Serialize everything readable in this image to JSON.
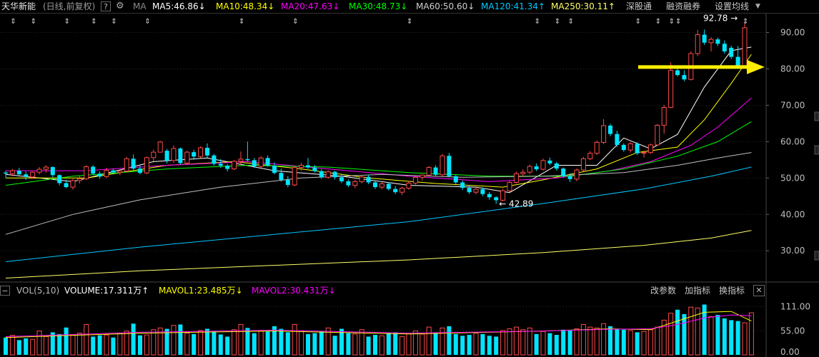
{
  "header": {
    "stock_name": "天华新能",
    "period_label": "(日线,前复权)",
    "info_icon": "question-icon",
    "gear_icon": "gear-icon",
    "ma_label": "MA",
    "ma5": "MA5:46.86",
    "ma10": "MA10:48.34",
    "ma20": "MA20:47.63",
    "ma30": "MA30:48.73",
    "ma60": "MA60:50.60",
    "ma120": "MA120:41.34",
    "ma250": "MA250:30.11",
    "ma5_arrow": "↓",
    "ma10_arrow": "↓",
    "ma20_arrow": "↓",
    "ma30_arrow": "↓",
    "ma60_arrow": "↓",
    "ma120_arrow": "↑",
    "ma250_arrow": "↑",
    "btn_shengu": "深股通",
    "btn_rongzi": "融资融券",
    "btn_settings": "设置均线",
    "dropdown_icon": "chevron-down-icon"
  },
  "volume_header": {
    "collapse_icon": "minus-icon",
    "vol_label": "VOL(5,10)",
    "volume": "VOLUME:17.311万",
    "volume_arrow": "↑",
    "mavol1": "MAVOL1:23.485万",
    "mavol1_arrow": "↓",
    "mavol2": "MAVOL2:30.431万",
    "mavol2_arrow": "↓",
    "btn_change_param": "改参数",
    "btn_add_indicator": "加指标",
    "btn_switch_indicator": "换指标",
    "close_icon": "close-icon"
  },
  "colors": {
    "up": "#ff4a4a",
    "down": "#00e4ff",
    "ma5": "#ffffff",
    "ma10": "#ffff00",
    "ma20": "#ff00ff",
    "ma30": "#00ff00",
    "ma60": "#c0c0c0",
    "ma120": "#00c8ff",
    "ma250": "#ffff66",
    "arrow": "#ffee00"
  },
  "chart_data": {
    "type": "candlestick",
    "price_axis": {
      "ticks": [
        "90.00",
        "80.00",
        "70.00",
        "60.00",
        "50.00",
        "40.00",
        "30.00"
      ],
      "ylim": [
        22,
        95
      ]
    },
    "volume_axis": {
      "ticks": [
        "111.00",
        "55.00",
        "0.00"
      ],
      "ylim": [
        0,
        130
      ]
    },
    "annotations": {
      "high_label": "92.78",
      "low_label": "42.89",
      "high_value": 92.78,
      "low_value": 42.89
    },
    "candles": [
      [
        51.5,
        52.0,
        50.0,
        51.2
      ],
      [
        51.2,
        52.5,
        50.5,
        52.0
      ],
      [
        52.0,
        52.8,
        50.8,
        51.0
      ],
      [
        51.0,
        51.8,
        49.5,
        50.3
      ],
      [
        50.3,
        51.8,
        49.8,
        51.6
      ],
      [
        51.6,
        53.0,
        51.0,
        52.4
      ],
      [
        52.4,
        53.5,
        51.5,
        53.0
      ],
      [
        53.0,
        53.2,
        50.2,
        50.8
      ],
      [
        50.8,
        51.0,
        48.0,
        48.6
      ],
      [
        48.6,
        49.5,
        47.2,
        47.5
      ],
      [
        47.5,
        49.8,
        46.8,
        49.3
      ],
      [
        49.3,
        50.5,
        48.5,
        49.8
      ],
      [
        49.8,
        53.5,
        49.5,
        53.1
      ],
      [
        53.1,
        53.5,
        50.8,
        51.2
      ],
      [
        51.2,
        51.8,
        49.8,
        50.4
      ],
      [
        50.4,
        52.8,
        50.0,
        52.1
      ],
      [
        52.1,
        52.6,
        51.0,
        51.5
      ],
      [
        51.5,
        52.2,
        50.8,
        51.9
      ],
      [
        51.9,
        55.8,
        51.6,
        55.3
      ],
      [
        55.3,
        56.5,
        52.2,
        52.6
      ],
      [
        52.6,
        53.4,
        51.0,
        51.4
      ],
      [
        51.4,
        55.9,
        51.0,
        55.6
      ],
      [
        55.6,
        57.8,
        54.6,
        57.1
      ],
      [
        57.1,
        60.2,
        57.0,
        59.9
      ],
      [
        57.5,
        58.0,
        54.0,
        54.8
      ],
      [
        54.8,
        59.0,
        54.2,
        58.1
      ],
      [
        58.1,
        58.4,
        53.8,
        54.1
      ],
      [
        54.1,
        57.5,
        53.6,
        57.1
      ],
      [
        57.1,
        57.8,
        55.0,
        55.9
      ],
      [
        55.9,
        58.7,
        55.5,
        58.3
      ],
      [
        58.3,
        59.5,
        55.5,
        56.2
      ],
      [
        56.2,
        56.6,
        53.4,
        53.9
      ],
      [
        53.9,
        55.2,
        52.8,
        53.4
      ],
      [
        53.4,
        53.8,
        51.8,
        52.5
      ],
      [
        52.5,
        54.9,
        52.2,
        54.6
      ],
      [
        54.6,
        57.3,
        53.8,
        55.2
      ],
      [
        55.2,
        60.0,
        54.6,
        54.9
      ],
      [
        54.9,
        55.5,
        52.8,
        53.2
      ],
      [
        53.2,
        56.0,
        52.8,
        55.5
      ],
      [
        55.5,
        56.2,
        53.1,
        53.4
      ],
      [
        53.4,
        54.3,
        51.0,
        51.4
      ],
      [
        51.4,
        52.6,
        49.0,
        49.5
      ],
      [
        49.5,
        50.5,
        47.5,
        48.1
      ],
      [
        48.1,
        53.2,
        47.8,
        52.9
      ],
      [
        52.9,
        54.2,
        52.0,
        53.5
      ],
      [
        53.5,
        55.5,
        52.5,
        52.9
      ],
      [
        52.9,
        53.6,
        51.5,
        51.9
      ],
      [
        51.9,
        52.5,
        49.8,
        50.2
      ],
      [
        50.2,
        52.1,
        49.8,
        51.7
      ],
      [
        51.7,
        52.0,
        49.6,
        50.2
      ],
      [
        50.2,
        51.2,
        48.6,
        49.1
      ],
      [
        49.1,
        49.6,
        47.5,
        48.0
      ],
      [
        48.0,
        49.5,
        47.2,
        49.0
      ],
      [
        49.0,
        50.7,
        48.5,
        50.3
      ],
      [
        50.3,
        50.9,
        48.3,
        48.8
      ],
      [
        48.8,
        49.4,
        47.0,
        47.5
      ],
      [
        47.5,
        49.0,
        46.9,
        48.4
      ],
      [
        48.4,
        48.8,
        46.6,
        47.0
      ],
      [
        47.0,
        47.8,
        45.6,
        46.1
      ],
      [
        46.1,
        47.6,
        45.3,
        47.2
      ],
      [
        47.2,
        49.2,
        46.8,
        48.6
      ],
      [
        48.6,
        50.6,
        48.2,
        50.2
      ],
      [
        50.2,
        51.0,
        49.3,
        50.8
      ],
      [
        50.8,
        53.3,
        50.4,
        52.9
      ],
      [
        52.9,
        53.5,
        50.5,
        50.9
      ],
      [
        50.9,
        56.6,
        50.5,
        56.1
      ],
      [
        56.1,
        56.9,
        50.2,
        50.5
      ],
      [
        50.5,
        50.9,
        48.3,
        48.8
      ],
      [
        48.8,
        49.3,
        46.7,
        47.3
      ],
      [
        47.3,
        48.1,
        45.6,
        46.1
      ],
      [
        46.1,
        47.5,
        45.5,
        46.9
      ],
      [
        46.9,
        47.4,
        45.0,
        45.6
      ],
      [
        45.6,
        46.2,
        44.0,
        44.7
      ],
      [
        44.7,
        45.0,
        42.89,
        43.9
      ],
      [
        43.9,
        47.0,
        43.6,
        46.5
      ],
      [
        46.5,
        49.2,
        46.1,
        48.8
      ],
      [
        48.8,
        51.8,
        48.5,
        51.2
      ],
      [
        51.2,
        52.4,
        50.3,
        51.6
      ],
      [
        51.6,
        53.7,
        51.0,
        53.2
      ],
      [
        53.2,
        54.0,
        51.9,
        52.4
      ],
      [
        52.4,
        55.3,
        52.0,
        54.8
      ],
      [
        54.8,
        55.6,
        53.5,
        54.0
      ],
      [
        54.0,
        54.4,
        52.0,
        52.6
      ],
      [
        52.6,
        52.9,
        50.1,
        50.5
      ],
      [
        50.5,
        51.3,
        48.9,
        49.7
      ],
      [
        49.7,
        52.6,
        49.1,
        52.2
      ],
      [
        52.2,
        55.8,
        51.8,
        55.3
      ],
      [
        55.3,
        57.4,
        54.9,
        56.8
      ],
      [
        56.8,
        60.3,
        56.3,
        59.8
      ],
      [
        59.8,
        66.2,
        59.3,
        64.4
      ],
      [
        64.4,
        64.9,
        61.5,
        62.1
      ],
      [
        62.1,
        63.0,
        58.6,
        59.1
      ],
      [
        59.1,
        59.5,
        57.2,
        57.7
      ],
      [
        57.7,
        59.9,
        57.0,
        59.4
      ],
      [
        59.4,
        59.8,
        56.3,
        56.8
      ],
      [
        56.8,
        57.5,
        55.6,
        57.0
      ],
      [
        57.0,
        59.5,
        56.6,
        59.1
      ],
      [
        59.1,
        64.9,
        58.8,
        64.5
      ],
      [
        64.5,
        70.1,
        62.2,
        69.4
      ],
      [
        69.4,
        81.8,
        69.2,
        79.6
      ],
      [
        79.6,
        80.9,
        77.9,
        78.3
      ],
      [
        78.3,
        79.6,
        76.6,
        77.1
      ],
      [
        77.1,
        84.8,
        76.8,
        84.2
      ],
      [
        84.2,
        90.7,
        83.5,
        89.4
      ],
      [
        89.4,
        90.8,
        86.6,
        87.2
      ],
      [
        87.2,
        88.7,
        84.8,
        88.1
      ],
      [
        88.1,
        88.6,
        86.3,
        86.9
      ],
      [
        86.9,
        87.8,
        84.2,
        84.8
      ],
      [
        85.8,
        86.4,
        82.7,
        83.3
      ],
      [
        83.3,
        86.3,
        80.3,
        80.9
      ],
      [
        80.9,
        92.78,
        80.5,
        91.3
      ]
    ],
    "volumes": [
      40,
      45,
      34,
      38,
      36,
      55,
      42,
      52,
      48,
      63,
      46,
      50,
      70,
      42,
      45,
      46,
      40,
      50,
      55,
      72,
      45,
      46,
      58,
      62,
      60,
      68,
      70,
      50,
      48,
      56,
      60,
      54,
      47,
      42,
      58,
      70,
      62,
      50,
      56,
      54,
      66,
      60,
      52,
      70,
      56,
      48,
      50,
      55,
      62,
      44,
      60,
      50,
      48,
      58,
      42,
      46,
      44,
      50,
      52,
      42,
      50,
      55,
      48,
      64,
      52,
      62,
      66,
      48,
      44,
      46,
      50,
      48,
      44,
      42,
      56,
      60,
      64,
      58,
      62,
      48,
      54,
      50,
      46,
      58,
      56,
      60,
      70,
      64,
      62,
      72,
      66,
      60,
      58,
      56,
      52,
      54,
      58,
      64,
      80,
      96,
      104,
      94,
      110,
      108,
      116,
      88,
      92,
      84,
      80,
      78,
      74,
      97
    ],
    "ma_series": [
      {
        "name": "MA5",
        "color": "#ffffff",
        "points": [
          [
            0,
            51
          ],
          [
            10,
            49
          ],
          [
            22,
            54.5
          ],
          [
            30,
            55.5
          ],
          [
            40,
            52
          ],
          [
            50,
            50.5
          ],
          [
            60,
            48
          ],
          [
            70,
            47.5
          ],
          [
            75,
            46
          ],
          [
            82,
            53.5
          ],
          [
            88,
            53.5
          ],
          [
            92,
            61
          ],
          [
            96,
            58
          ],
          [
            100,
            62
          ],
          [
            104,
            75
          ],
          [
            108,
            85
          ],
          [
            111,
            86
          ]
        ]
      },
      {
        "name": "MA10",
        "color": "#ffff00",
        "points": [
          [
            0,
            50
          ],
          [
            12,
            50
          ],
          [
            24,
            53.5
          ],
          [
            34,
            54.5
          ],
          [
            44,
            52.5
          ],
          [
            54,
            50
          ],
          [
            64,
            48.5
          ],
          [
            74,
            47.5
          ],
          [
            80,
            49.5
          ],
          [
            88,
            52.5
          ],
          [
            94,
            57
          ],
          [
            100,
            58.5
          ],
          [
            104,
            66
          ],
          [
            108,
            76
          ],
          [
            111,
            84
          ]
        ]
      },
      {
        "name": "MA20",
        "color": "#ff00ff",
        "points": [
          [
            0,
            52
          ],
          [
            12,
            52
          ],
          [
            24,
            53.5
          ],
          [
            36,
            54.5
          ],
          [
            48,
            52.5
          ],
          [
            60,
            50.5
          ],
          [
            72,
            49
          ],
          [
            82,
            50
          ],
          [
            90,
            52
          ],
          [
            96,
            54.5
          ],
          [
            102,
            59
          ],
          [
            106,
            64
          ],
          [
            111,
            72
          ]
        ]
      },
      {
        "name": "MA30",
        "color": "#00ff00",
        "points": [
          [
            0,
            48
          ],
          [
            10,
            50.5
          ],
          [
            24,
            52.5
          ],
          [
            36,
            53.5
          ],
          [
            48,
            53
          ],
          [
            60,
            51.5
          ],
          [
            72,
            50.5
          ],
          [
            84,
            50.5
          ],
          [
            92,
            52.5
          ],
          [
            100,
            56
          ],
          [
            106,
            60
          ],
          [
            111,
            65.5
          ]
        ]
      },
      {
        "name": "MA60",
        "color": "#c0c0c0",
        "points": [
          [
            0,
            34.5
          ],
          [
            10,
            40
          ],
          [
            20,
            44
          ],
          [
            32,
            47.5
          ],
          [
            44,
            50
          ],
          [
            56,
            51
          ],
          [
            68,
            50.2
          ],
          [
            80,
            50.5
          ],
          [
            92,
            51.5
          ],
          [
            100,
            53.5
          ],
          [
            106,
            55.5
          ],
          [
            111,
            57
          ]
        ]
      },
      {
        "name": "MA120",
        "color": "#00c8ff",
        "points": [
          [
            0,
            27
          ],
          [
            20,
            31
          ],
          [
            40,
            34.5
          ],
          [
            60,
            38
          ],
          [
            80,
            43
          ],
          [
            95,
            47
          ],
          [
            105,
            50.5
          ],
          [
            111,
            53
          ]
        ]
      },
      {
        "name": "MA250",
        "color": "#ffff66",
        "points": [
          [
            0,
            22.5
          ],
          [
            20,
            24.5
          ],
          [
            40,
            26
          ],
          [
            60,
            27.5
          ],
          [
            80,
            29.5
          ],
          [
            95,
            31.5
          ],
          [
            105,
            33.5
          ],
          [
            111,
            35.6
          ]
        ]
      }
    ],
    "mavol_series": [
      {
        "name": "MAVOL1",
        "color": "#ffff00",
        "points": [
          [
            0,
            40
          ],
          [
            20,
            50
          ],
          [
            40,
            55
          ],
          [
            60,
            48
          ],
          [
            80,
            55
          ],
          [
            90,
            60
          ],
          [
            96,
            58
          ],
          [
            100,
            78
          ],
          [
            104,
            98
          ],
          [
            108,
            100
          ],
          [
            111,
            78
          ]
        ]
      },
      {
        "name": "MAVOL2",
        "color": "#ff00ff",
        "points": [
          [
            0,
            42
          ],
          [
            20,
            52
          ],
          [
            40,
            57
          ],
          [
            60,
            50
          ],
          [
            80,
            55
          ],
          [
            90,
            59
          ],
          [
            96,
            60
          ],
          [
            100,
            70
          ],
          [
            104,
            85
          ],
          [
            108,
            92
          ],
          [
            111,
            90
          ]
        ]
      }
    ]
  }
}
